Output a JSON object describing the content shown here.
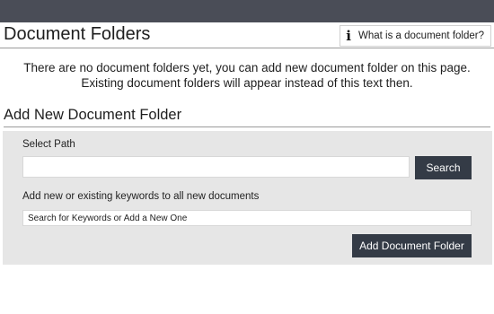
{
  "header": {
    "title": "Document Folders",
    "help_link_label": "What is a document folder?",
    "help_icon": "info-icon"
  },
  "empty_state": {
    "line1": "There are no document folders yet, you can add new document folder on this page.",
    "line2": "Existing document folders will appear instead of this text then."
  },
  "add_section": {
    "title": "Add New Document Folder",
    "path_label": "Select Path",
    "path_value": "",
    "search_button_label": "Search",
    "keywords_label": "Add new or existing keywords to all new documents",
    "keywords_placeholder": "Search for Keywords or Add a New One",
    "add_button_label": "Add Document Folder"
  },
  "colors": {
    "top_bar": "#4a4d57",
    "button_bg": "#343b46",
    "panel_bg": "#e6e6e6"
  }
}
